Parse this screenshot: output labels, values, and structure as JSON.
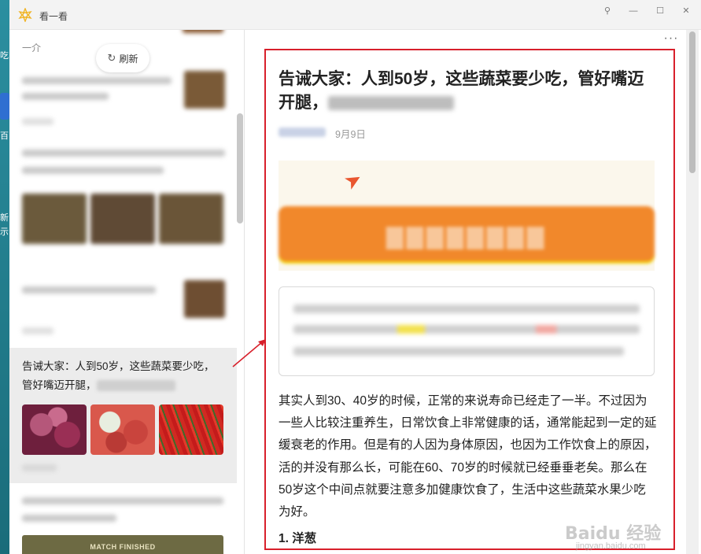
{
  "window": {
    "title": "看一看",
    "controls": {
      "pin": "⚲",
      "minimize": "—",
      "maximize": "☐",
      "close": "✕"
    }
  },
  "feed": {
    "header_label": "一介",
    "refresh_label": "刷新",
    "selected_item": {
      "title": "告诫大家：人到50岁，这些蔬菜要少吃，管好嘴迈开腿，"
    },
    "bottom_banner": "MATCH FINISHED"
  },
  "article": {
    "more_label": "···",
    "title": "告诫大家：人到50岁，这些蔬菜要少吃，管好嘴迈开腿，",
    "date": "9月9日",
    "body": "其实人到30、40岁的时候，正常的来说寿命已经走了一半。不过因为一些人比较注重养生，日常饮食上非常健康的话，通常能起到一定的延缓衰老的作用。但是有的人因为身体原因，也因为工作饮食上的原因，活的并没有那么长，可能在60、70岁的时候就已经垂垂老矣。那么在50岁这个中间点就要注意多加健康饮食了，生活中这些蔬菜水果少吃为好。",
    "subhead": "1. 洋葱"
  },
  "watermark": {
    "brand": "Baidu 经验",
    "url": "jingyan.baidu.com"
  },
  "colors": {
    "highlight_frame": "#d8202b",
    "banner_orange": "#f1882b"
  }
}
